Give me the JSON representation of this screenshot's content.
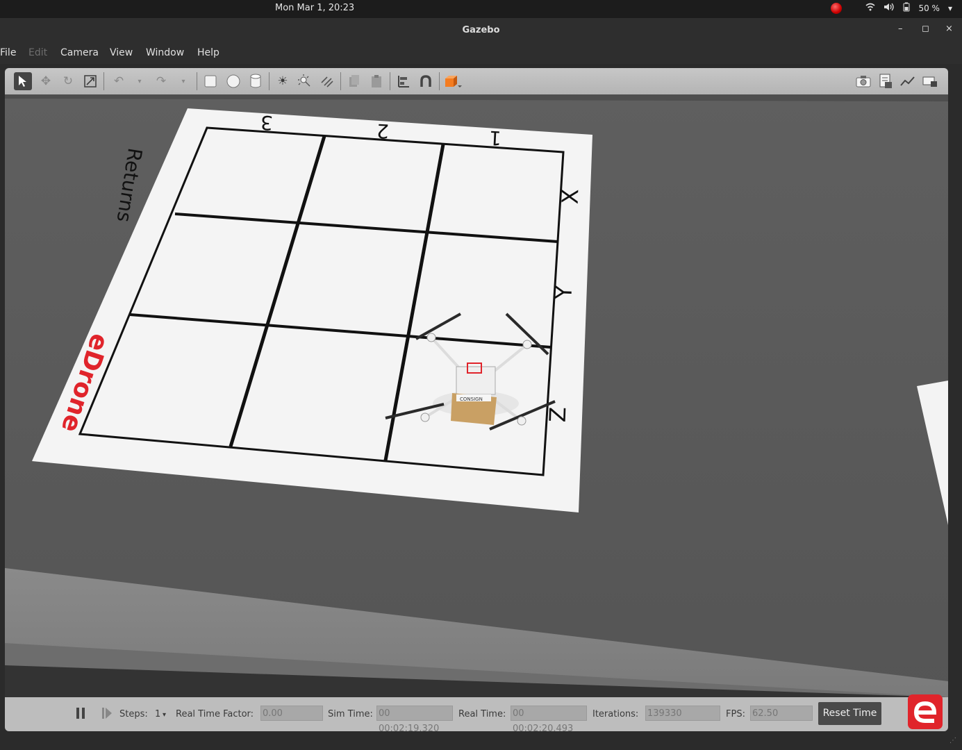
{
  "system_bar": {
    "clock": "Mon Mar  1, 20:23",
    "battery": "50 %",
    "icons": [
      "record-indicator-icon",
      "wifi-icon",
      "volume-icon",
      "battery-icon",
      "caret-down-icon"
    ]
  },
  "window": {
    "title": "Gazebo",
    "controls": {
      "minimize": "–",
      "maximize": "◻",
      "close": "×"
    }
  },
  "menu": {
    "items": [
      {
        "label": "File",
        "enabled": true
      },
      {
        "label": "Edit",
        "enabled": false
      },
      {
        "label": "Camera",
        "enabled": true
      },
      {
        "label": "View",
        "enabled": true
      },
      {
        "label": "Window",
        "enabled": true
      },
      {
        "label": "Help",
        "enabled": true
      }
    ]
  },
  "toolbar": {
    "tools": [
      "select-arrow-icon",
      "translate-icon",
      "rotate-icon",
      "scale-icon",
      "undo-icon",
      "undo-history-icon",
      "redo-icon",
      "redo-history-icon",
      "box-shape-icon",
      "sphere-shape-icon",
      "cylinder-shape-icon",
      "point-light-icon",
      "spot-light-icon",
      "directional-light-icon",
      "copy-icon",
      "paste-icon",
      "align-icon",
      "snap-icon",
      "change-view-icon"
    ],
    "right_tools": [
      "screenshot-icon",
      "log-icon",
      "plot-icon",
      "video-record-icon"
    ]
  },
  "scene": {
    "grid_top_labels": [
      "3",
      "2",
      "1"
    ],
    "grid_right_labels": [
      "X",
      "Y",
      "Z"
    ],
    "returns_label": "Returns",
    "brand_label": "eDrone",
    "package_label": "CONSIGN"
  },
  "bottom_bar": {
    "steps_label": "Steps:",
    "steps_value": "1",
    "real_time_factor_label": "Real Time Factor:",
    "real_time_factor_value": "0.00",
    "sim_time_label": "Sim Time:",
    "sim_time_value": "00 00:02:19.320",
    "real_time_label": "Real Time:",
    "real_time_value": "00 00:02:20.493",
    "iterations_label": "Iterations:",
    "iterations_value": "139330",
    "fps_label": "FPS:",
    "fps_value": "62.50",
    "reset_button": "Reset Time"
  },
  "colors": {
    "brand_red": "#e0242b",
    "ground": "#5a5a5a",
    "sheet": "#f4f4f4"
  }
}
